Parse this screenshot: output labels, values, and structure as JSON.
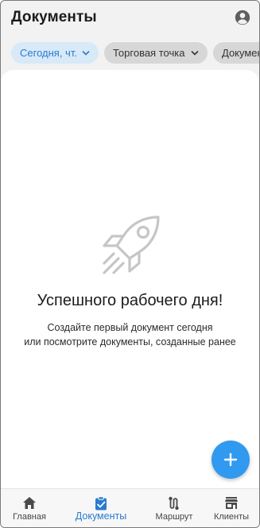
{
  "header": {
    "title": "Документы",
    "account_icon": "account-circle-icon"
  },
  "filters": {
    "date_chip": "Сегодня, чт.",
    "store_chip": "Торговая точка",
    "docs_chip": "Докумен"
  },
  "empty_state": {
    "icon": "rocket-icon",
    "title": "Успешного рабочего дня!",
    "subtitle_line1": "Создайте первый документ сегодня",
    "subtitle_line2": "или посмотрите документы, созданные ранее"
  },
  "fab": {
    "icon": "plus-icon"
  },
  "bottom_nav": {
    "items": [
      {
        "label": "Главная",
        "icon": "home-icon"
      },
      {
        "label": "Документы",
        "icon": "clipboard-check-icon",
        "active": true
      },
      {
        "label": "Маршрут",
        "icon": "route-icon"
      },
      {
        "label": "Клиенты",
        "icon": "store-icon"
      }
    ]
  },
  "colors": {
    "accent": "#2f9af0",
    "accent_text": "#2a7ad0",
    "chip_active_bg": "#d8e9f8",
    "chip_bg": "#d7d7d7",
    "background": "#f2f2f2"
  }
}
